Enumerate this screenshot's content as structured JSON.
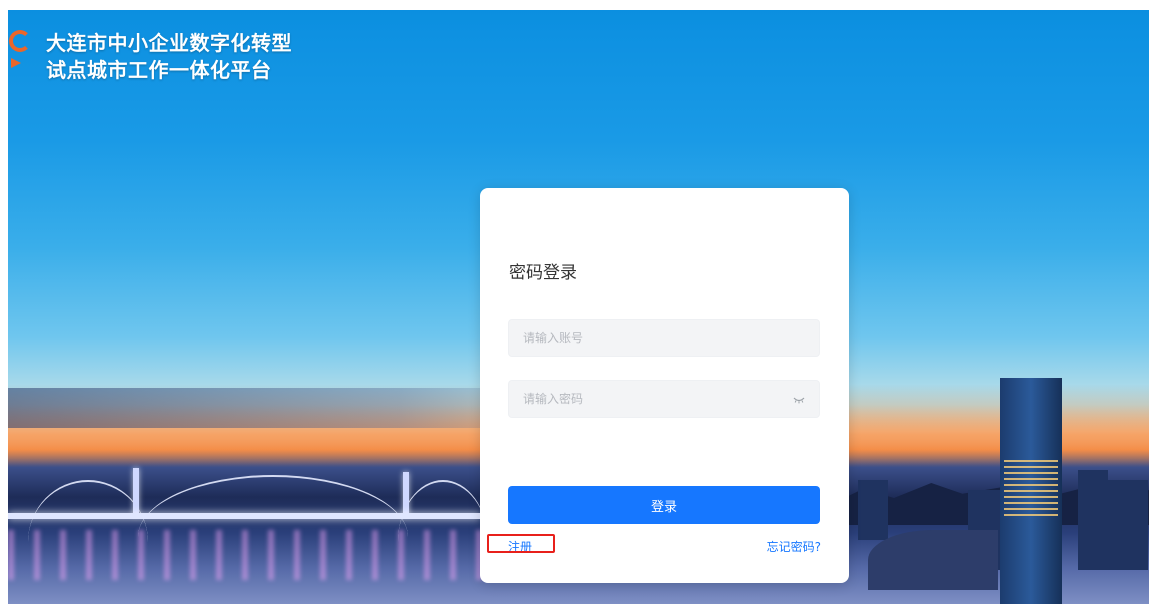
{
  "brand": {
    "title_line1": "大连市中小企业数字化转型",
    "title_line2": "试点城市工作一体化平台",
    "logo_icon": "platform-logo-icon",
    "logo_color": "#e9662a"
  },
  "login": {
    "title": "密码登录",
    "account_placeholder": "请输入账号",
    "password_placeholder": "请输入密码",
    "password_toggle_icon": "eye-closed-icon",
    "submit_label": "登录",
    "register_label": "注册",
    "forgot_label": "忘记密码?"
  },
  "colors": {
    "primary": "#1677ff",
    "highlight": "#e8201b"
  }
}
